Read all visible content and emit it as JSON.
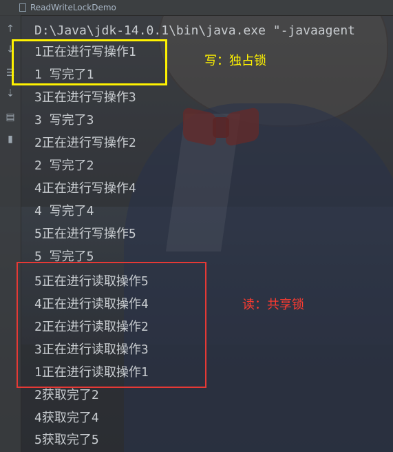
{
  "window": {
    "tab_title": "ReadWriteLockDemo"
  },
  "toolbar": {
    "icons": [
      "arrow-up-icon",
      "arrow-down-icon",
      "soft-wrap-icon",
      "scroll-to-end-icon",
      "print-icon",
      "trash-icon"
    ]
  },
  "console": {
    "command": "D:\\Java\\jdk-14.0.1\\bin\\java.exe \"-javaagent",
    "lines": [
      "1正在进行写操作1",
      "1 写完了1",
      "3正在进行写操作3",
      "3 写完了3",
      "2正在进行写操作2",
      "2 写完了2",
      "4正在进行写操作4",
      "4 写完了4",
      "5正在进行写操作5",
      "5 写完了5",
      "5正在进行读取操作5",
      "4正在进行读取操作4",
      "2正在进行读取操作2",
      "3正在进行读取操作3",
      "1正在进行读取操作1",
      "2获取完了2",
      "4获取完了4",
      "5获取完了5"
    ]
  },
  "annotations": {
    "write_note": "写：独占锁",
    "read_note": "读：共享锁",
    "write_color": "#fff200",
    "read_color": "#e53935"
  }
}
